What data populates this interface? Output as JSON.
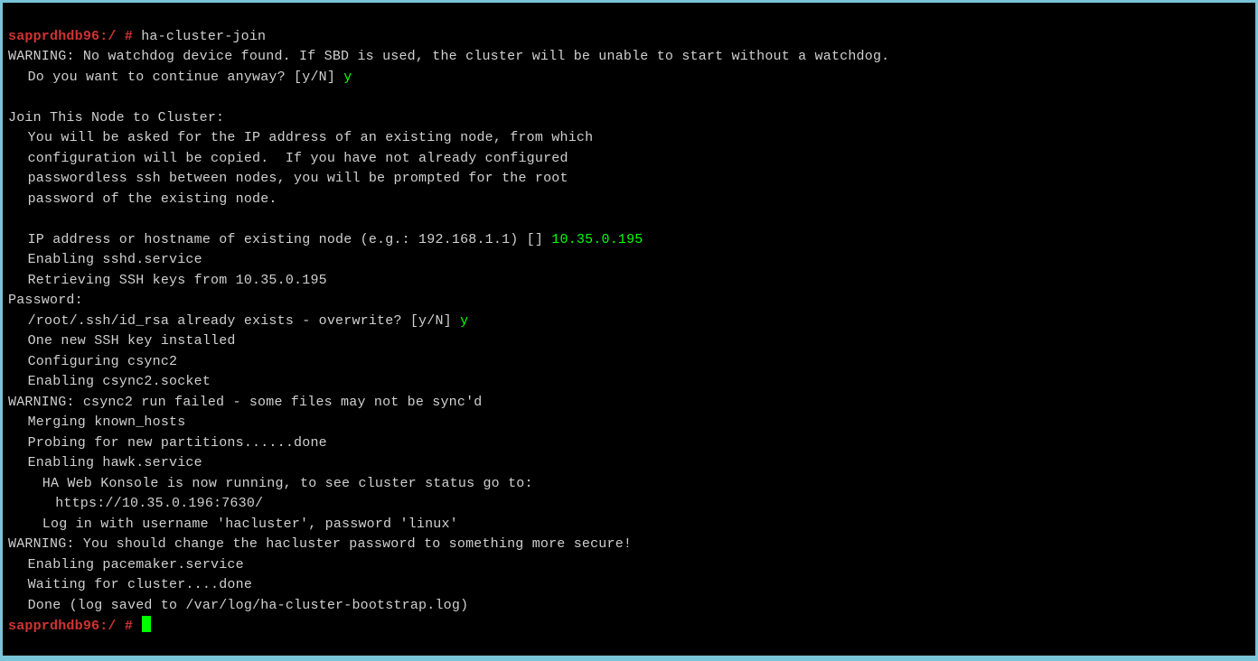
{
  "prompt1": {
    "host": "sapprdhdb96:/ #",
    "command": " ha-cluster-join"
  },
  "lines": {
    "warn1": "WARNING: No watchdog device found. If SBD is used, the cluster will be unable to start without a watchdog.",
    "continue_prompt": "Do you want to continue anyway? [y/N]",
    "continue_ans": " y",
    "join_header": "Join This Node to Cluster:",
    "j1": "You will be asked for the IP address of an existing node, from which",
    "j2": "configuration will be copied.  If you have not already configured",
    "j3": "passwordless ssh between nodes, you will be prompted for the root",
    "j4": "password of the existing node.",
    "ip_prompt": "IP address or hostname of existing node (e.g.: 192.168.1.1) []",
    "ip_ans": " 10.35.0.195",
    "sshd": "Enabling sshd.service",
    "retrieve": "Retrieving SSH keys from 10.35.0.195",
    "password": "Password:",
    "overwrite_prompt": "/root/.ssh/id_rsa already exists - overwrite? [y/N]",
    "overwrite_ans": " y",
    "sshkey": "One new SSH key installed",
    "csync2a": "Configuring csync2",
    "csync2b": "Enabling csync2.socket",
    "warn2": "WARNING: csync2 run failed - some files may not be sync'd",
    "merge": "Merging known_hosts",
    "probe": "Probing for new partitions......done",
    "hawk": "Enabling hawk.service",
    "hawk1": "HA Web Konsole is now running, to see cluster status go to:",
    "hawk2": "https://10.35.0.196:7630/",
    "hawk3": "Log in with username 'hacluster', password 'linux'",
    "warn3": "WARNING: You should change the hacluster password to something more secure!",
    "pacemaker": "Enabling pacemaker.service",
    "waiting": "Waiting for cluster....done",
    "done": "Done (log saved to /var/log/ha-cluster-bootstrap.log)"
  },
  "prompt2": {
    "host": "sapprdhdb96:/ #"
  }
}
